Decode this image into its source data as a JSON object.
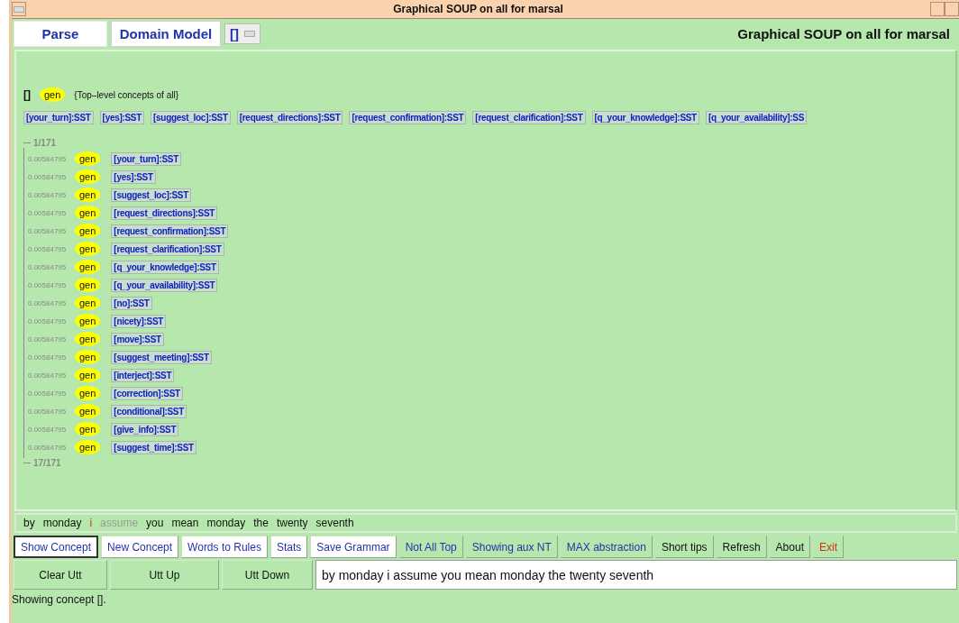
{
  "window": {
    "title": "Graphical SOUP on all for marsal"
  },
  "tabs": [
    {
      "label": "Parse",
      "selected": false
    },
    {
      "label": "Domain Model",
      "selected": true
    }
  ],
  "concept_selector": {
    "value": "[]"
  },
  "header_title": "Graphical SOUP on all for marsal",
  "top_concept": {
    "name": "[]",
    "tag": "gen",
    "description": "{Top–level concepts of all}"
  },
  "top_chips": [
    "[your_turn]:SST",
    "[yes]:SST",
    "[suggest_loc]:SST",
    "[request_directions]:SST",
    "[request_confirmation]:SST",
    "[request_clarification]:SST",
    "[q_your_knowledge]:SST",
    "[q_your_availability]:SS"
  ],
  "tree": {
    "start": "1/171",
    "end": "17/171",
    "rows": [
      {
        "score": "0.00584795",
        "tag": "gen",
        "concept": "[your_turn]:SST"
      },
      {
        "score": "0.00584795",
        "tag": "gen",
        "concept": "[yes]:SST"
      },
      {
        "score": "0.00584795",
        "tag": "gen",
        "concept": "[suggest_loc]:SST"
      },
      {
        "score": "0.00584795",
        "tag": "gen",
        "concept": "[request_directions]:SST"
      },
      {
        "score": "0.00584795",
        "tag": "gen",
        "concept": "[request_confirmation]:SST"
      },
      {
        "score": "0.00584795",
        "tag": "gen",
        "concept": "[request_clarification]:SST"
      },
      {
        "score": "0.00584795",
        "tag": "gen",
        "concept": "[q_your_knowledge]:SST"
      },
      {
        "score": "0.00584795",
        "tag": "gen",
        "concept": "[q_your_availability]:SST"
      },
      {
        "score": "0.00584795",
        "tag": "gen",
        "concept": "[no]:SST"
      },
      {
        "score": "0.00584795",
        "tag": "gen",
        "concept": "[nicety]:SST"
      },
      {
        "score": "0.00584795",
        "tag": "gen",
        "concept": "[move]:SST"
      },
      {
        "score": "0.00584795",
        "tag": "gen",
        "concept": "[suggest_meeting]:SST"
      },
      {
        "score": "0.00584795",
        "tag": "gen",
        "concept": "[interject]:SST"
      },
      {
        "score": "0.00584795",
        "tag": "gen",
        "concept": "[correction]:SST"
      },
      {
        "score": "0.00584795",
        "tag": "gen",
        "concept": "[conditional]:SST"
      },
      {
        "score": "0.00584795",
        "tag": "gen",
        "concept": "[give_info]:SST"
      },
      {
        "score": "0.00584795",
        "tag": "gen",
        "concept": "[suggest_time]:SST"
      }
    ]
  },
  "utterance_tokens": [
    {
      "word": "by",
      "kind": "normal"
    },
    {
      "word": "monday",
      "kind": "normal"
    },
    {
      "word": "i",
      "kind": "current"
    },
    {
      "word": "assume",
      "kind": "dim"
    },
    {
      "word": "you",
      "kind": "normal"
    },
    {
      "word": "mean",
      "kind": "normal"
    },
    {
      "word": "monday",
      "kind": "normal"
    },
    {
      "word": "the",
      "kind": "normal"
    },
    {
      "word": "twenty",
      "kind": "normal"
    },
    {
      "word": "seventh",
      "kind": "normal"
    }
  ],
  "toolbar": [
    {
      "label": "Show Concept",
      "kind": "white",
      "selected": true
    },
    {
      "label": "New Concept",
      "kind": "white",
      "selected": false
    },
    {
      "label": "Words to Rules",
      "kind": "white",
      "selected": false
    },
    {
      "label": "Stats",
      "kind": "white",
      "selected": false
    },
    {
      "label": "Save Grammar",
      "kind": "white",
      "selected": false
    },
    {
      "label": "Not All Top",
      "kind": "toggle",
      "selected": false
    },
    {
      "label": "Showing aux NT",
      "kind": "toggle",
      "selected": false
    },
    {
      "label": "MAX abstraction",
      "kind": "toggle",
      "selected": false
    },
    {
      "label": "Short tips",
      "kind": "plain",
      "selected": false
    },
    {
      "label": "Refresh",
      "kind": "plain",
      "selected": false
    },
    {
      "label": "About",
      "kind": "plain",
      "selected": false
    },
    {
      "label": "Exit",
      "kind": "danger",
      "selected": false
    }
  ],
  "utterance_buttons": [
    "Clear Utt",
    "Utt Up",
    "Utt Down"
  ],
  "utterance_field": {
    "value": "by monday i assume you mean monday the twenty seventh"
  },
  "status_bar": "Showing concept []."
}
